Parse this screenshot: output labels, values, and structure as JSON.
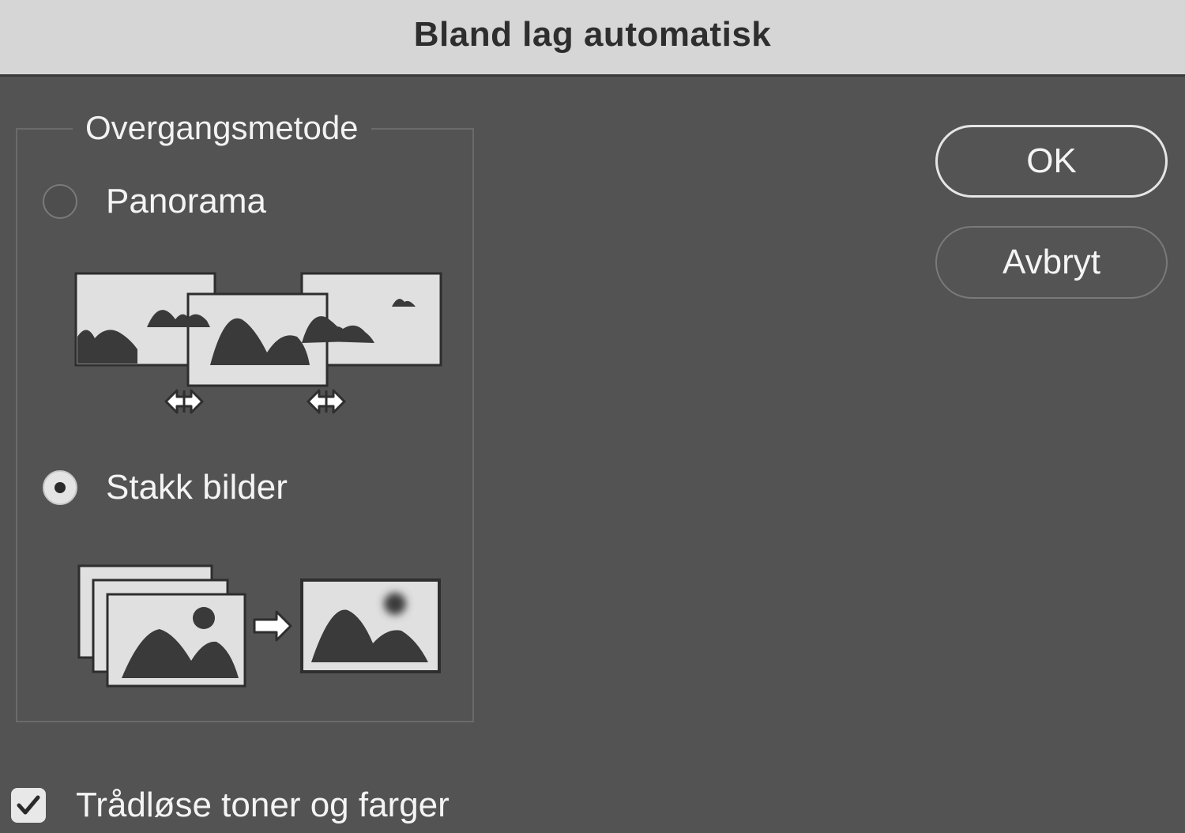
{
  "dialog": {
    "title": "Bland lag automatisk"
  },
  "group": {
    "legend": "Overgangsmetode",
    "options": [
      {
        "label": "Panorama",
        "selected": false
      },
      {
        "label": "Stakk bilder",
        "selected": true
      }
    ]
  },
  "buttons": {
    "ok_label": "OK",
    "cancel_label": "Avbryt"
  },
  "checkbox": {
    "label": "Trådløse toner og farger",
    "checked": true
  },
  "colors": {
    "background": "#535353",
    "titlebar": "#d6d6d6",
    "text": "#f4f4f4",
    "illustration_fill": "#e0e0e0",
    "illustration_dark": "#3a3a3a"
  },
  "icons": {
    "panorama_illustration": "panorama-illustration-icon",
    "stack_illustration": "stack-images-illustration-icon",
    "checkmark": "checkmark-icon"
  }
}
